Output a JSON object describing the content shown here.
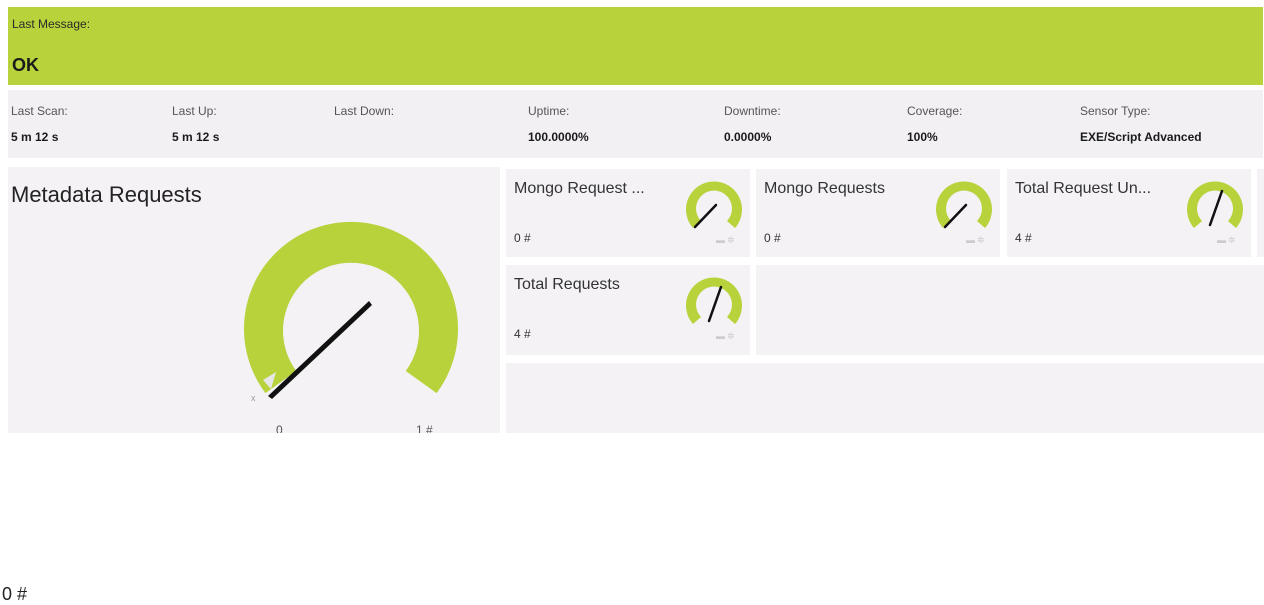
{
  "status": {
    "label": "Last Message:",
    "value": "OK"
  },
  "stats": [
    {
      "key": "Last Scan:",
      "value": "5 m 12 s"
    },
    {
      "key": "Last Up:",
      "value": "5 m 12 s"
    },
    {
      "key": "Last Down:",
      "value": ""
    },
    {
      "key": "Uptime:",
      "value": "100.0000%"
    },
    {
      "key": "Downtime:",
      "value": "0.0000%"
    },
    {
      "key": "Coverage:",
      "value": "100%"
    },
    {
      "key": "Sensor Type:",
      "value": "EXE/Script Advanced"
    }
  ],
  "main_gauge": {
    "title": "Metadata Requests",
    "value_label": "0 #",
    "min_label": "0",
    "max_label": "1 #",
    "tick_label": "x",
    "value": 0
  },
  "channels": [
    {
      "title": "Mongo Request ...",
      "value": "0 #"
    },
    {
      "title": "Mongo Requests",
      "value": "0 #"
    },
    {
      "title": "Total Request Un...",
      "value": "4 #"
    },
    {
      "title": "Total Requests",
      "value": "4 #"
    }
  ],
  "colors": {
    "accent": "#b7d23a",
    "panel": "#f4f2f5",
    "needle": "#111111"
  },
  "icons": [
    "pin-icon",
    "gear-icon"
  ]
}
